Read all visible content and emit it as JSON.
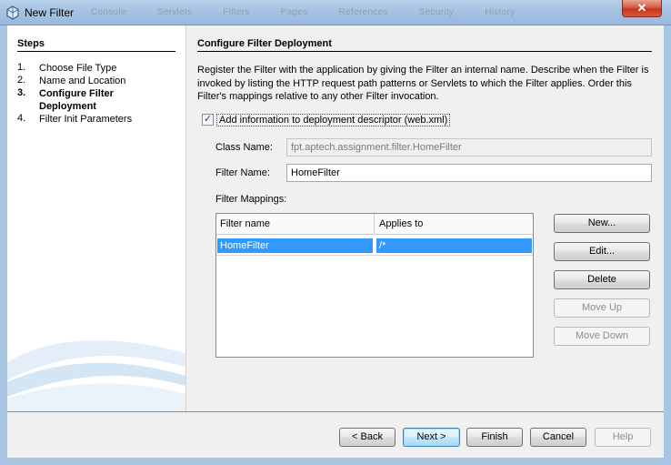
{
  "window": {
    "title": "New Filter",
    "close_glyph": "✕",
    "background_tabs": [
      "Console",
      "Servlets",
      "Filters",
      "Pages",
      "References",
      "Security",
      "History"
    ]
  },
  "steps": {
    "title": "Steps",
    "items": [
      {
        "num": "1.",
        "label": "Choose File Type"
      },
      {
        "num": "2.",
        "label": "Name and Location"
      },
      {
        "num": "3.",
        "label": "Configure Filter Deployment"
      },
      {
        "num": "4.",
        "label": "Filter Init Parameters"
      }
    ]
  },
  "main": {
    "title": "Configure Filter Deployment",
    "description": "Register the Filter with the application by giving the Filter an internal name. Describe when the Filter is invoked by listing the HTTP request path patterns or Servlets to which the Filter applies. Order this Filter's mappings relative to any other Filter invocation.",
    "checkbox": {
      "label": "Add information to deployment descriptor (web.xml)",
      "checked": true,
      "glyph": "✓"
    },
    "class_name": {
      "label": "Class Name:",
      "value": "fpt.aptech.assignment.filter.HomeFilter"
    },
    "filter_name": {
      "label": "Filter Name:",
      "value": "HomeFilter"
    },
    "mappings": {
      "label": "Filter Mappings:",
      "columns": [
        "Filter name",
        "Applies to"
      ],
      "rows": [
        [
          "HomeFilter",
          "/*"
        ]
      ]
    },
    "buttons": {
      "new": "New...",
      "edit": "Edit...",
      "delete": "Delete",
      "move_up": "Move Up",
      "move_down": "Move Down"
    }
  },
  "footer": {
    "back": "< Back",
    "next": "Next >",
    "finish": "Finish",
    "cancel": "Cancel",
    "help": "Help"
  },
  "colors": {
    "selection": "#3399ff",
    "titlebar": "#a6c3e2",
    "close_button": "#c7331a"
  }
}
